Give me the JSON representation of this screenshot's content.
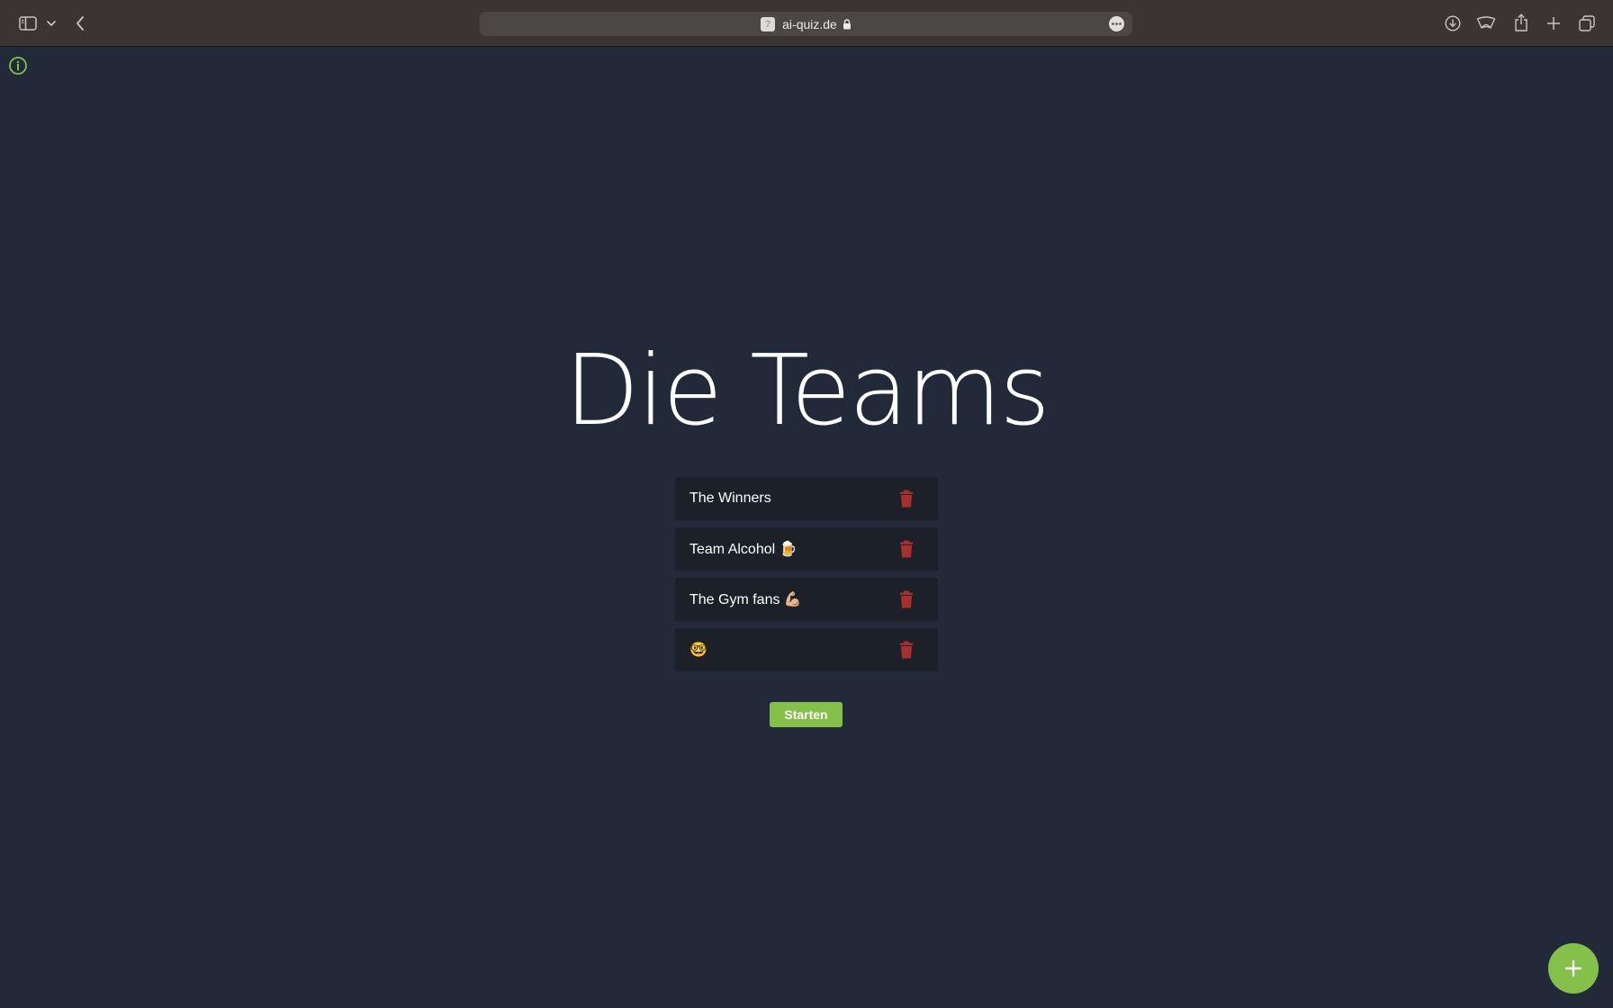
{
  "browser": {
    "url": "ai-quiz.de",
    "favicon_glyph": "?",
    "icons": [
      "sidebar-icon",
      "chevron-down-icon",
      "back-icon",
      "lock-icon",
      "more-icon",
      "download-icon",
      "reader-icon",
      "share-icon",
      "plus-icon",
      "tabs-icon"
    ]
  },
  "page": {
    "title": "Die Teams",
    "teams": [
      {
        "name": "The Winners"
      },
      {
        "name": "Team Alcohol 🍺"
      },
      {
        "name": "The Gym fans 💪🏼"
      },
      {
        "name": "🤓"
      }
    ],
    "start_label": "Starten",
    "colors": {
      "background": "#222a39",
      "accent": "#84c04a",
      "delete": "#a8302c",
      "row": "#1b2029"
    }
  }
}
